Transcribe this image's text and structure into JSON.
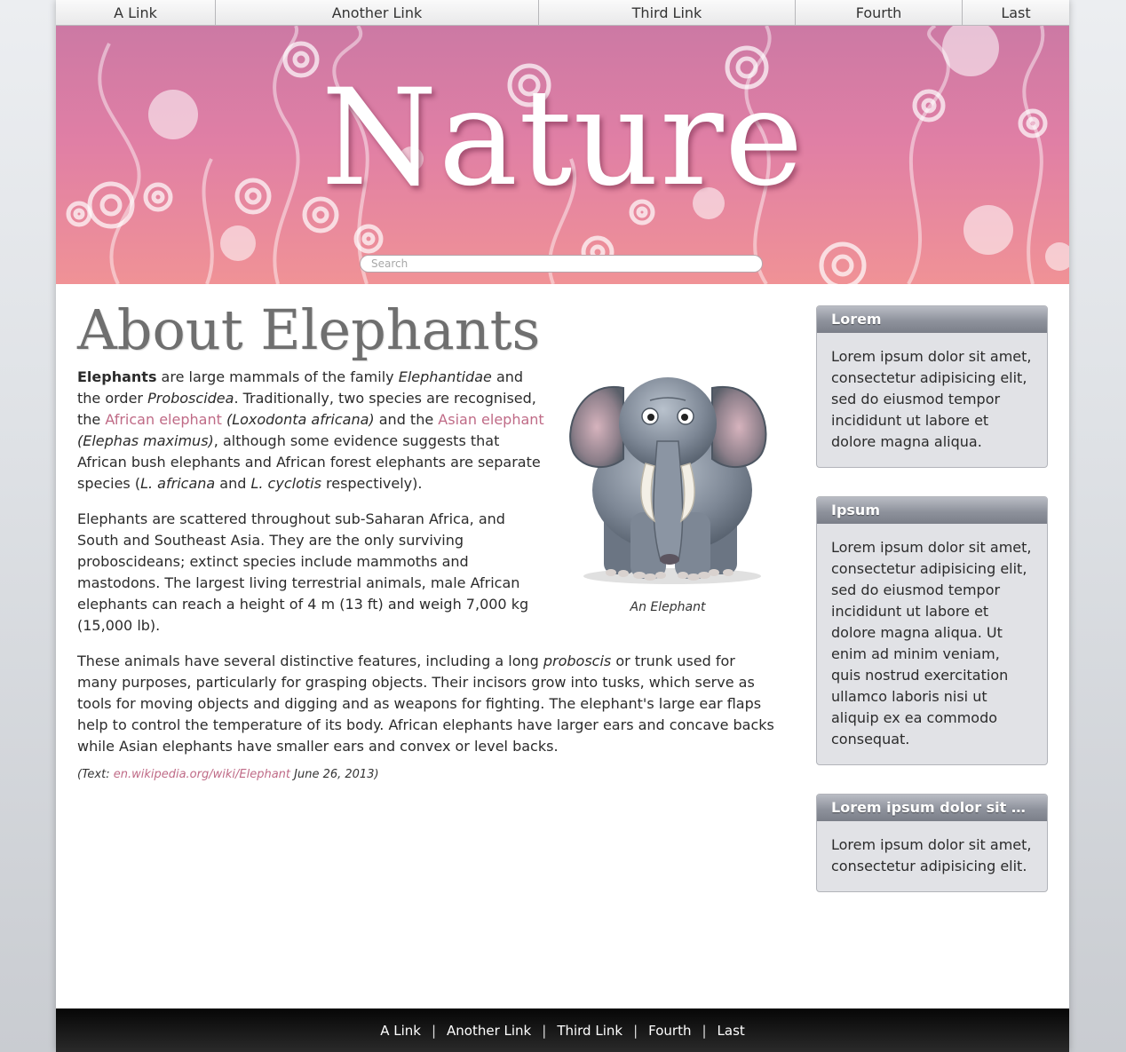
{
  "top_nav": {
    "items": [
      {
        "label": "A Link"
      },
      {
        "label": "Another Link"
      },
      {
        "label": "Third Link"
      },
      {
        "label": "Fourth"
      },
      {
        "label": "Last"
      }
    ]
  },
  "header": {
    "site_title": "Nature",
    "search_placeholder": "Search"
  },
  "article": {
    "title": "About Elephants",
    "figure_caption": "An Elephant",
    "p1": {
      "bold_lead": "Elephants",
      "t1": " are large mammals of the family ",
      "i1": "Elephantidae",
      "t2": " and the order ",
      "i2": "Proboscidea",
      "t3": ". Traditionally, two species are recognised, the ",
      "link1": "African elephant",
      "i3": " (Loxodonta africana)",
      "t4": " and the ",
      "link2": "Asian elephant",
      "i4": " (Elephas maximus)",
      "t5": ", although some evidence suggests that African bush elephants and African forest elephants are separate species (",
      "i5": "L. africana",
      "t6": " and ",
      "i6": "L. cyclotis",
      "t7": " respectively)."
    },
    "p2": "Elephants are scattered throughout sub-Saharan Africa, and South and Southeast Asia. They are the only surviving proboscideans; extinct species include mammoths and mastodons. The largest living terrestrial animals, male African elephants can reach a height of 4 m (13 ft) and weigh 7,000 kg (15,000 lb).",
    "p3": {
      "t1": "These animals have several distinctive features, including a long ",
      "i1": "proboscis",
      "t2": " or trunk used for many purposes, particularly for grasping objects. Their incisors grow into tusks, which serve as tools for moving objects and digging and as weapons for fighting. The elephant's large ear flaps help to control the temperature of its body. African elephants have larger ears and concave backs while Asian elephants have smaller ears and convex or level backs."
    },
    "source": {
      "prefix": "(Text: ",
      "link": "en.wikipedia.org/wiki/Elephant",
      "suffix": " June 26, 2013)"
    }
  },
  "sidebar": {
    "boxes": [
      {
        "title": "Lorem",
        "body": "Lorem ipsum dolor sit amet, consectetur adipisicing elit, sed do eiusmod tempor incididunt ut labore et dolore magna aliqua."
      },
      {
        "title": "Ipsum",
        "body": "Lorem ipsum dolor sit amet, consectetur adipisicing elit, sed do eiusmod tempor incididunt ut labore et dolore magna aliqua. Ut enim ad minim veniam, quis nostrud exercitation ullamco laboris nisi ut aliquip ex ea commodo consequat."
      },
      {
        "title": "Lorem ipsum dolor sit amet",
        "body": "Lorem ipsum dolor sit amet, consectetur adipisicing elit."
      }
    ]
  },
  "footer": {
    "separator": "|",
    "items": [
      {
        "label": "A Link"
      },
      {
        "label": "Another Link"
      },
      {
        "label": "Third Link"
      },
      {
        "label": "Fourth"
      },
      {
        "label": "Last"
      }
    ]
  },
  "colors": {
    "link": "#bf6a86",
    "header_top": "#cc79a4",
    "header_bottom": "#f09296",
    "sidebar_box_bg": "#e1e2e6",
    "footer_bg": "#1a1a1a"
  }
}
